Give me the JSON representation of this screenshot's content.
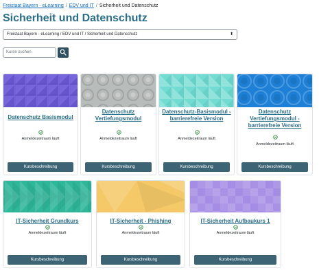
{
  "breadcrumb": {
    "items": [
      "Freistaat Bayern - eLearning",
      "EDV und IT",
      "Sicherheit und Datenschutz"
    ],
    "separator": "/"
  },
  "page_title": "Sicherheit und Datenschutz",
  "category_select": {
    "value": "Freistaat Bayern - eLearning / EDV und IT / Sicherheit und Datenschutz",
    "caret": "⬍"
  },
  "search": {
    "placeholder": "Kurse suchen",
    "icon": "search-icon"
  },
  "status_icon": "check-circle-icon",
  "colors": {
    "title": "#2b6e87",
    "link": "#0f6cbf",
    "button": "#3d6474",
    "status_check": "#2f8a3b"
  },
  "courses": [
    {
      "title": "Datenschutz Basismodul",
      "status": "Anmeldezeitraum läuft",
      "button": "Kursbeschreibung",
      "image_color": "#6c5ad8"
    },
    {
      "title": "Datenschutz Vertiefungsmodul",
      "status": "Anmeldezeitraum läuft",
      "button": "Kursbeschreibung",
      "image_color": "#b8bcbb"
    },
    {
      "title": "Datenschutz-Basismodul - barrierefreie Version",
      "status": "Anmeldezeitraum läuft",
      "button": "Kursbeschreibung",
      "image_color": "#72dcd3"
    },
    {
      "title": "Datenschutz Vertiefungsmodul - barrierefreie Version",
      "status": "Anmeldezeitraum läuft",
      "button": "Kursbeschreibung",
      "image_color": "#1d7fd6"
    },
    {
      "title": "IT-Sicherheit Grundkurs",
      "status": "Anmeldezeitraum läuft",
      "button": "Kursbeschreibung",
      "image_color": "#2fb79a"
    },
    {
      "title": "IT-Sicherheit - Phishing",
      "status": "Anmeldezeitraum läuft",
      "button": "Kursbeschreibung",
      "image_color": "#f5c968"
    },
    {
      "title": "IT-Sicherheit Aufbaukurs 1",
      "status": "Anmeldezeitraum läuft",
      "button": "Kursbeschreibung",
      "image_color": "#a58ce4"
    }
  ]
}
